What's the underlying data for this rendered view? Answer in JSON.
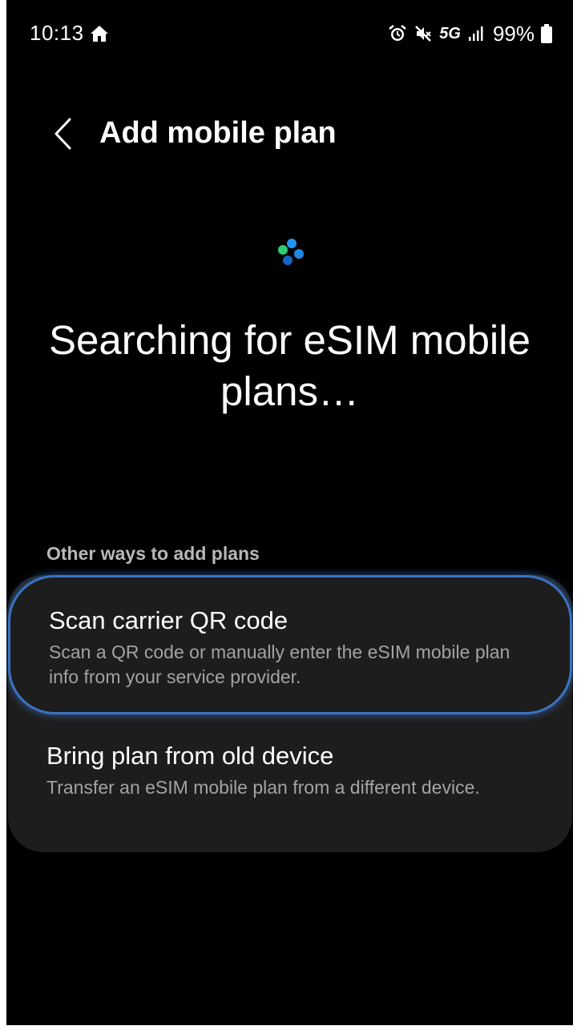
{
  "status_bar": {
    "time": "10:13",
    "network": "5G",
    "battery": "99%",
    "icons": [
      "home-icon",
      "alarm-icon",
      "mute-icon",
      "signal-icon",
      "battery-icon"
    ]
  },
  "header": {
    "back_icon": "chevron-left-icon",
    "title": "Add mobile plan"
  },
  "main": {
    "spinner_colors": [
      "#2ecc71",
      "#2196f3",
      "#1565c0"
    ],
    "headline": "Searching for eSIM mobile plans…",
    "section_label": "Other ways to add plans",
    "options": [
      {
        "title": "Scan carrier QR code",
        "description": "Scan a QR code or manually enter the eSIM mobile plan info from your service provider."
      },
      {
        "title": "Bring plan from old device",
        "description": "Transfer an eSIM mobile plan from a different device."
      }
    ]
  },
  "colors": {
    "background": "#000000",
    "card": "#1d1d1d",
    "focus_outline": "#3a73c4",
    "secondary_text": "#a3a3a3"
  }
}
